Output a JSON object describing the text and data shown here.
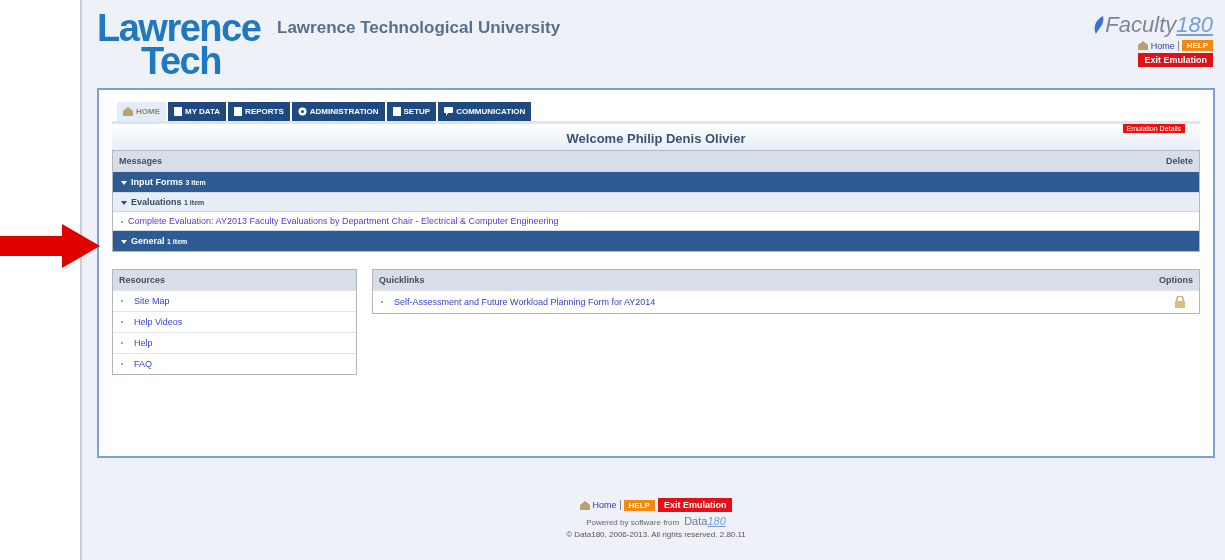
{
  "header": {
    "logo_line1": "Lawrence",
    "logo_line2": "Tech",
    "title": "Lawrence Technological University",
    "product": "Faculty",
    "product_number": "180",
    "home_link": "Home",
    "help_button": "HELP",
    "exit_button": "Exit Emulation"
  },
  "tabs": [
    {
      "label": "HOME",
      "selected": true
    },
    {
      "label": "MY DATA",
      "selected": false
    },
    {
      "label": "REPORTS",
      "selected": false
    },
    {
      "label": "ADMINISTRATION",
      "selected": false
    },
    {
      "label": "SETUP",
      "selected": false
    },
    {
      "label": "COMMUNICATION",
      "selected": false
    }
  ],
  "welcome": "Welcome Philip Denis Olivier",
  "emulation_details_button": "Emulation Details",
  "messages": {
    "title": "Messages",
    "delete_label": "Delete",
    "groups": [
      {
        "label": "Input Forms",
        "count": "3 item",
        "expanded": true,
        "children": [
          {
            "label": "Evaluations",
            "count": "1 item",
            "expanded": true,
            "children": [
              {
                "label": "Complete Evaluation: AY2013 Faculty Evaluations by Department Chair - Electrical & Computer Engineering"
              }
            ]
          }
        ]
      },
      {
        "label": "General",
        "count": "1 item",
        "expanded": true
      }
    ]
  },
  "resources": {
    "title": "Resources",
    "items": [
      "Site Map",
      "Help Videos",
      "Help",
      "FAQ"
    ]
  },
  "quicklinks": {
    "title": "Quicklinks",
    "options_label": "Options",
    "items": [
      "Self-Assessment and Future Workload Planning Form for AY2014"
    ]
  },
  "footer": {
    "home_link": "Home",
    "help_button": "HELP",
    "exit_button": "Exit Emulation",
    "powered_by": "Powered by software from",
    "brand": "Data",
    "brand_number": "180",
    "copyright": "© Data180, 2006-2013. All rights reserved. 2.80.11"
  }
}
